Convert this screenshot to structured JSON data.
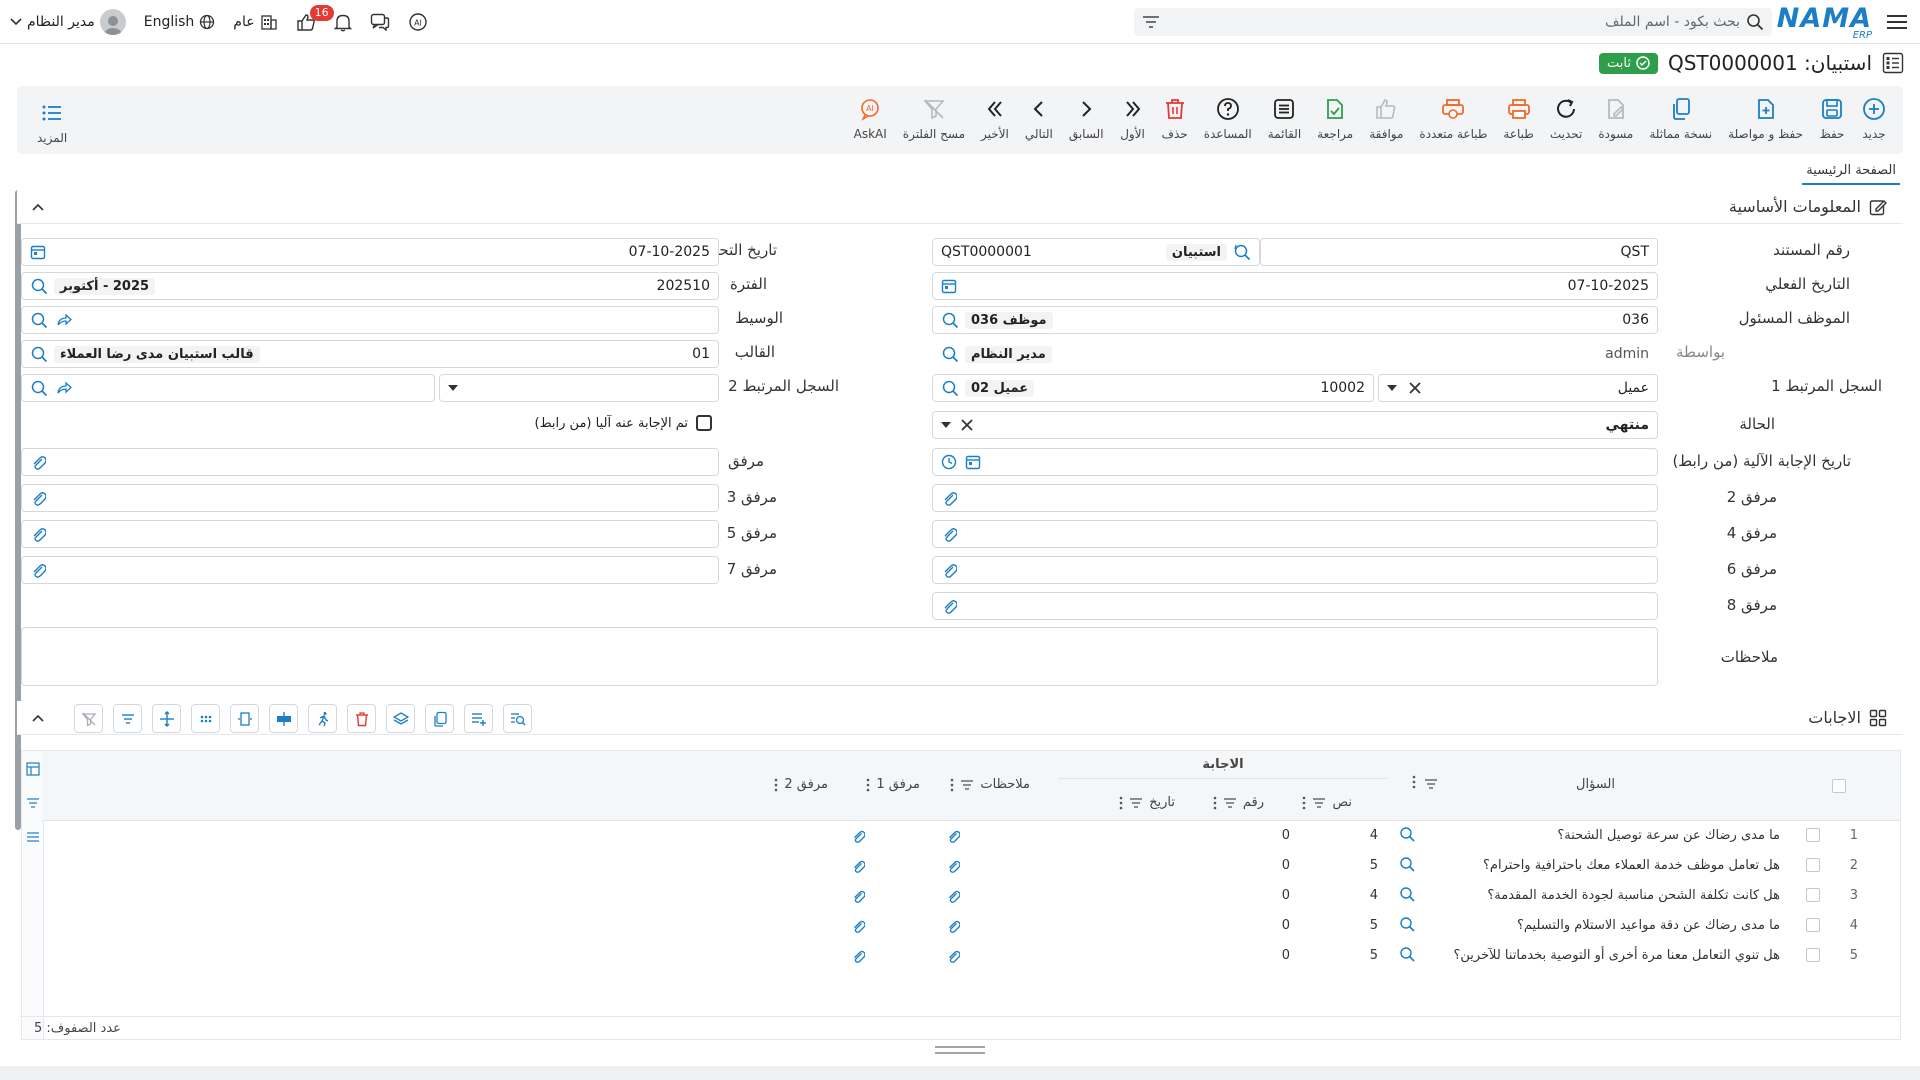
{
  "topbar": {
    "logo": "NAMA",
    "logo_sub": "ERP",
    "search_placeholder": "بحث بكود - اسم الملف",
    "user_name": "مدير النظام",
    "language": "English",
    "company": "عام",
    "likes_badge": "16"
  },
  "title": {
    "text": "استبيان: QST0000001",
    "status": "ثابت"
  },
  "toolbar": {
    "buttons": [
      {
        "label": "جديد",
        "icon": "plus-circle-icon"
      },
      {
        "label": "حفظ",
        "icon": "save-icon"
      },
      {
        "label": "حفظ و مواصلة",
        "icon": "save-continue-icon"
      },
      {
        "label": "نسخة مماثلة",
        "icon": "duplicate-icon"
      },
      {
        "label": "مسودة",
        "icon": "draft-icon"
      },
      {
        "label": "تحديث",
        "icon": "refresh-icon"
      },
      {
        "label": "طباعة",
        "icon": "print-icon"
      },
      {
        "label": "طباعة متعددة",
        "icon": "multi-print-icon"
      },
      {
        "label": "موافقة",
        "icon": "approve-icon"
      },
      {
        "label": "مراجعة",
        "icon": "review-icon"
      },
      {
        "label": "القائمة",
        "icon": "list-icon"
      },
      {
        "label": "المساعدة",
        "icon": "help-icon"
      },
      {
        "label": "حذف",
        "icon": "delete-icon"
      },
      {
        "label": "الأول",
        "icon": "first-icon"
      },
      {
        "label": "السابق",
        "icon": "previous-icon"
      },
      {
        "label": "التالي",
        "icon": "next-icon"
      },
      {
        "label": "الأخير",
        "icon": "last-icon"
      },
      {
        "label": "مسح الفلترة",
        "icon": "clear-filter-icon"
      },
      {
        "label": "AskAI",
        "icon": "askai-icon"
      }
    ],
    "more_label": "المزيد"
  },
  "tabs": [
    "الصفحة الرئيسية"
  ],
  "sections": {
    "basic_info": "المعلومات الأساسية",
    "answers": "الاجابات"
  },
  "form": {
    "doc_number": {
      "label": "رقم المستند",
      "prefix": "QST",
      "chip": "استبيان",
      "value": "QST0000001"
    },
    "edit_date": {
      "label": "تاريخ التحرير",
      "value": "07-10-2025"
    },
    "actual_date": {
      "label": "التاريخ الفعلي",
      "value": "07-10-2025"
    },
    "period": {
      "label": "الفترة",
      "value": "202510",
      "chip": "2025 - أكتوبر"
    },
    "responsible_employee": {
      "label": "الموظف المسئول",
      "value": "036",
      "chip": "موظف 036"
    },
    "mediator": {
      "label": "الوسيط",
      "value": ""
    },
    "by": {
      "label": "بواسطة",
      "value": "admin",
      "chip": "مدير النظام"
    },
    "template": {
      "label": "القالب",
      "value": "01",
      "chip": "قالب استبيان مدى رضا العملاء"
    },
    "related1": {
      "label": "السجل المرتبط 1",
      "type": "عميل",
      "value": "10002",
      "chip": "عميل 02"
    },
    "related2": {
      "label": "السجل المرتبط 2",
      "value": ""
    },
    "state": {
      "label": "الحالة",
      "value": "منتهي"
    },
    "auto_answered": {
      "label": "تم الإجابة عنه آليا (من رابط)"
    },
    "auto_answer_date": {
      "label": "تاريخ الإجابة الآلية (من رابط)"
    },
    "attachments": [
      "مرفق",
      "مرفق 2",
      "مرفق 3",
      "مرفق 4",
      "مرفق 5",
      "مرفق 6",
      "مرفق 7",
      "مرفق 8"
    ],
    "notes": {
      "label": "ملاحظات",
      "value": ""
    }
  },
  "table": {
    "headers": {
      "question": "السؤال",
      "answer": "الاجابة",
      "text": "نص",
      "number": "رقم",
      "date": "تاريخ",
      "notes": "ملاحظات",
      "attachment1": "مرفق 1",
      "attachment2": "مرفق 2"
    },
    "rows": [
      {
        "n": "1",
        "question": "ما مدى رضاك عن سرعة توصيل الشحنة؟",
        "text": "4",
        "number": "0"
      },
      {
        "n": "2",
        "question": "هل تعامل موظف خدمة العملاء معك باحترافية واحترام؟",
        "text": "5",
        "number": "0"
      },
      {
        "n": "3",
        "question": "هل كانت تكلفة الشحن مناسبة لجودة الخدمة المقدمة؟",
        "text": "4",
        "number": "0"
      },
      {
        "n": "4",
        "question": "ما مدى رضاك عن دقة مواعيد الاستلام والتسليم؟",
        "text": "5",
        "number": "0"
      },
      {
        "n": "5",
        "question": "هل تنوي التعامل معنا مرة أخرى أو التوصية بخدماتنا للآخرين؟",
        "text": "5",
        "number": "0"
      }
    ],
    "rows_count_label": "عدد الصفوف: 5"
  },
  "colors": {
    "accent": "#1a7ec8",
    "status_green": "#2e9e4a",
    "danger": "#e53935",
    "orange": "#f06a2a"
  }
}
